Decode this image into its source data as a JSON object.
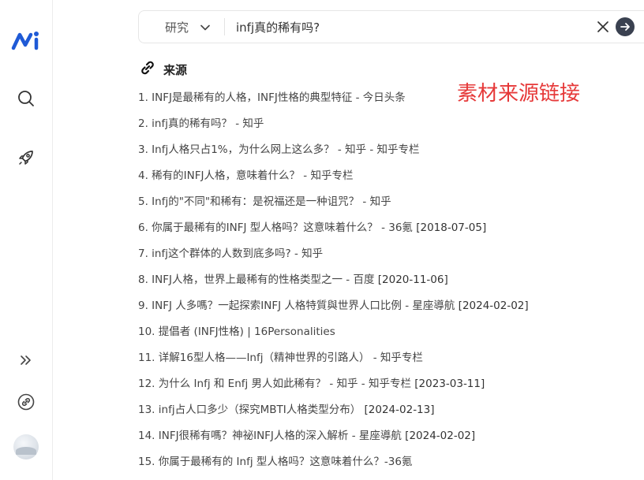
{
  "search": {
    "mode": "研究",
    "query": "infj真的稀有吗?"
  },
  "sources": {
    "title": "来源",
    "annotation": "素材来源链接",
    "items": [
      {
        "text": "1. INFJ是最稀有的人格，INFJ性格的典型特征 - 今日头条",
        "date": ""
      },
      {
        "text": "2. infj真的稀有吗？ - 知乎",
        "date": ""
      },
      {
        "text": "3. Infj人格只占1%，为什么网上这么多？ - 知乎 - 知乎专栏",
        "date": ""
      },
      {
        "text": "4. 稀有的INFJ人格，意味着什么？ - 知乎专栏",
        "date": ""
      },
      {
        "text": "5. Infj的\"不同\"和稀有：是祝福还是一种诅咒？ - 知乎",
        "date": ""
      },
      {
        "text": "6. 你属于最稀有的INFJ 型人格吗？这意味着什么？ - 36氪",
        "date": "[2018-07-05]"
      },
      {
        "text": "7. infj这个群体的人数到底多吗? - 知乎",
        "date": ""
      },
      {
        "text": "8. INFJ人格，世界上最稀有的性格类型之一 - 百度",
        "date": "[2020-11-06]"
      },
      {
        "text": "9. INFJ 人多嗎？一起探索INFJ 人格特質與世界人口比例 - 星座導航",
        "date": "[2024-02-02]"
      },
      {
        "text": "10. 提倡者 (INFJ性格) | 16Personalities",
        "date": ""
      },
      {
        "text": "11. 详解16型人格——Infj（精神世界的引路人） - 知乎专栏",
        "date": ""
      },
      {
        "text": "12. 为什么 Infj 和 Enfj 男人如此稀有？ - 知乎 - 知乎专栏",
        "date": "[2023-03-11]"
      },
      {
        "text": "13. infj占人口多少（探究MBTI人格类型分布）",
        "date": "[2024-02-13]"
      },
      {
        "text": "14. INFJ很稀有嗎？神祕INFJ人格的深入解析 - 星座導航",
        "date": "[2024-02-02]"
      },
      {
        "text": "15. 你属于最稀有的 Infj 型人格吗？这意味着什么？-36氪",
        "date": ""
      }
    ]
  },
  "colors": {
    "logo": "#1f5ad6",
    "annotation": "#e63939",
    "submit": "#3a4150"
  }
}
